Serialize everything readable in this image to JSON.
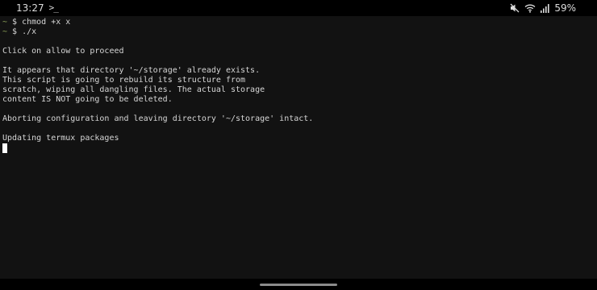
{
  "status_bar": {
    "time": "13:27",
    "app_icon": "termux-prompt-icon",
    "icons": [
      "mute-icon",
      "wifi-icon",
      "signal-icon"
    ],
    "battery": "59%"
  },
  "terminal": {
    "lines": [
      {
        "prompt": "~",
        "text": " $ chmod +x x"
      },
      {
        "prompt": "~",
        "text": " $ ./x"
      },
      {
        "prompt": "",
        "text": ""
      },
      {
        "prompt": "",
        "text": "Click on allow to proceed"
      },
      {
        "prompt": "",
        "text": ""
      },
      {
        "prompt": "",
        "text": "It appears that directory '~/storage' already exists."
      },
      {
        "prompt": "",
        "text": "This script is going to rebuild its structure from"
      },
      {
        "prompt": "",
        "text": "scratch, wiping all dangling files. The actual storage"
      },
      {
        "prompt": "",
        "text": "content IS NOT going to be deleted."
      },
      {
        "prompt": "",
        "text": ""
      },
      {
        "prompt": "",
        "text": "Aborting configuration and leaving directory '~/storage' intact."
      },
      {
        "prompt": "",
        "text": ""
      },
      {
        "prompt": "",
        "text": "Updating termux packages"
      }
    ]
  },
  "colors": {
    "terminal_bg": "#121212",
    "text": "#d6d6d6",
    "prompt": "#8fa65a"
  }
}
